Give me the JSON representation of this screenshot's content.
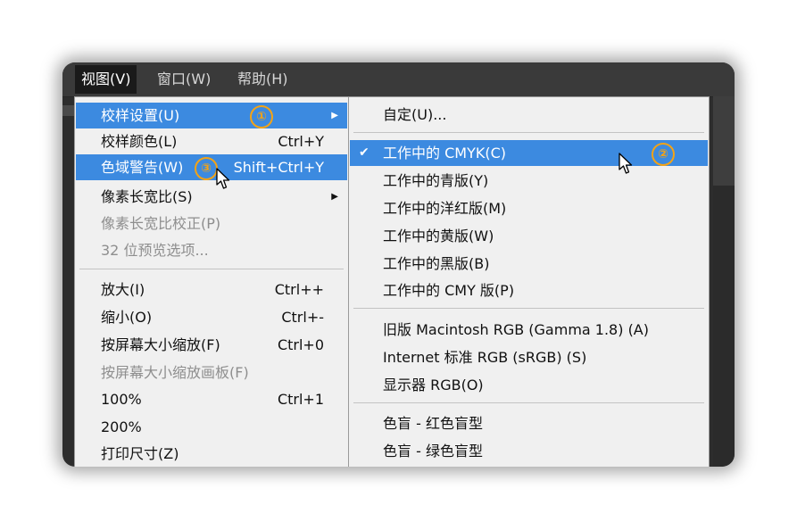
{
  "menubar": [
    "视图(V)",
    "窗口(W)",
    "帮助(H)"
  ],
  "view_menu": [
    {
      "label": "校样设置(U)",
      "shortcut": "",
      "submenu": true,
      "state": "highlight",
      "badge": "1"
    },
    {
      "label": "校样颜色(L)",
      "shortcut": "Ctrl+Y",
      "submenu": false,
      "state": "normal"
    },
    {
      "label": "色域警告(W)",
      "shortcut": "Shift+Ctrl+Y",
      "submenu": false,
      "state": "highlight",
      "badge": "3"
    },
    {
      "label": "像素长宽比(S)",
      "shortcut": "",
      "submenu": true,
      "state": "normal"
    },
    {
      "label": "像素长宽比校正(P)",
      "shortcut": "",
      "submenu": false,
      "state": "disabled"
    },
    {
      "label": "32 位预览选项...",
      "shortcut": "",
      "submenu": false,
      "state": "disabled"
    },
    {
      "label": "放大(I)",
      "shortcut": "Ctrl++",
      "submenu": false,
      "state": "normal"
    },
    {
      "label": "缩小(O)",
      "shortcut": "Ctrl+-",
      "submenu": false,
      "state": "normal"
    },
    {
      "label": "按屏幕大小缩放(F)",
      "shortcut": "Ctrl+0",
      "submenu": false,
      "state": "normal"
    },
    {
      "label": "按屏幕大小缩放画板(F)",
      "shortcut": "",
      "submenu": false,
      "state": "disabled"
    },
    {
      "label": "100%",
      "shortcut": "Ctrl+1",
      "submenu": false,
      "state": "normal"
    },
    {
      "label": "200%",
      "shortcut": "",
      "submenu": false,
      "state": "normal"
    },
    {
      "label": "打印尺寸(Z)",
      "shortcut": "",
      "submenu": false,
      "state": "normal"
    }
  ],
  "proof_setup_submenu": [
    {
      "label": "自定(U)...",
      "checked": false,
      "state": "normal"
    },
    {
      "label": "工作中的 CMYK(C)",
      "checked": true,
      "state": "highlight",
      "badge": "2"
    },
    {
      "label": "工作中的青版(Y)",
      "checked": false,
      "state": "normal"
    },
    {
      "label": "工作中的洋红版(M)",
      "checked": false,
      "state": "normal"
    },
    {
      "label": "工作中的黄版(W)",
      "checked": false,
      "state": "normal"
    },
    {
      "label": "工作中的黑版(B)",
      "checked": false,
      "state": "normal"
    },
    {
      "label": "工作中的 CMY 版(P)",
      "checked": false,
      "state": "normal"
    },
    {
      "label": "旧版 Macintosh RGB (Gamma 1.8) (A)",
      "checked": false,
      "state": "normal"
    },
    {
      "label": "Internet 标准 RGB (sRGB) (S)",
      "checked": false,
      "state": "normal"
    },
    {
      "label": "显示器 RGB(O)",
      "checked": false,
      "state": "normal"
    },
    {
      "label": "色盲 - 红色盲型",
      "checked": false,
      "state": "normal"
    },
    {
      "label": "色盲 - 绿色盲型",
      "checked": false,
      "state": "normal"
    }
  ],
  "badges": {
    "b1": "①",
    "b2": "②",
    "b3": "③"
  },
  "icons": {
    "submenu": "triangle-right-icon",
    "check": "checkmark-icon",
    "cursor": "mouse-pointer-icon"
  },
  "colors": {
    "highlight": "#3c8ae0",
    "badge": "#f3a316",
    "menu_bg": "#f0f0f0",
    "app_bg": "#2d2d2d"
  }
}
